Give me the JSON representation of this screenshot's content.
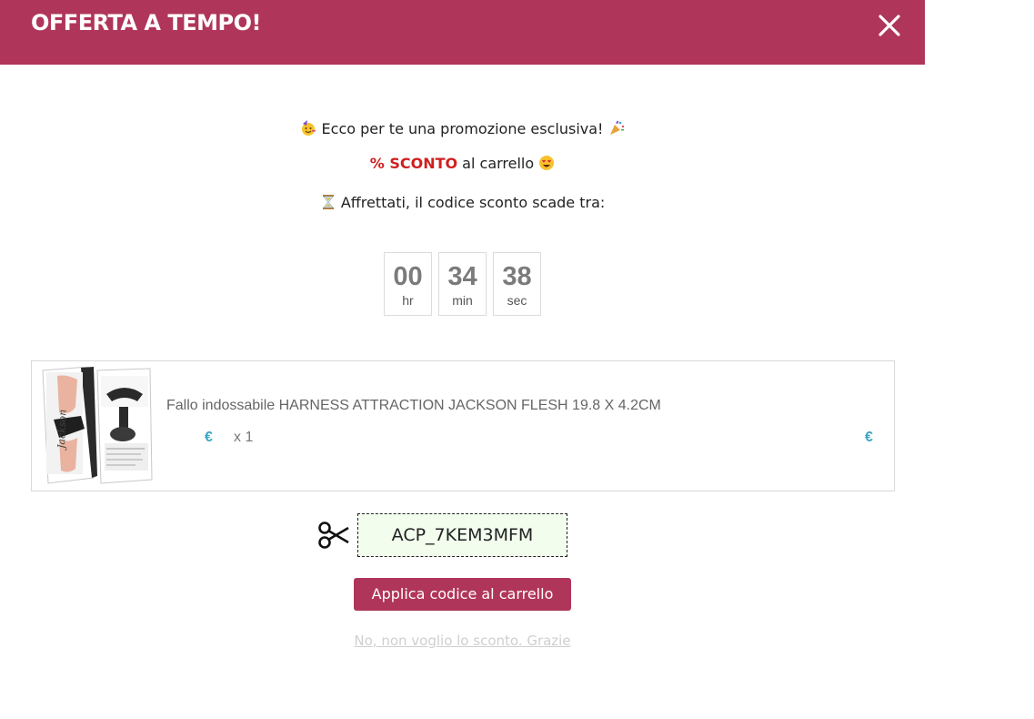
{
  "header": {
    "title": "OFFERTA A TEMPO!"
  },
  "promo": {
    "line1": "Ecco per te una promozione esclusiva!",
    "line2_highlight": "%  SCONTO",
    "line2_rest": " al carrello",
    "line3": "Affrettati, il codice sconto scade tra:"
  },
  "timer": {
    "hours": "00",
    "hours_label": "hr",
    "minutes": "34",
    "minutes_label": "min",
    "seconds": "38",
    "seconds_label": "sec"
  },
  "product": {
    "name": "Fallo indossabile HARNESS ATTRACTION JACKSON FLESH 19.8 X 4.2CM",
    "price_unit": "€",
    "quantity": "x 1",
    "price_total": "€",
    "image_brand_text": "Jackson"
  },
  "coupon": {
    "code": "ACP_7KEM3MFM"
  },
  "actions": {
    "apply_label": "Applica codice al carrello",
    "decline_label": "No, non voglio lo sconto. Grazie"
  },
  "icons": {
    "close": "close-icon",
    "party_face": "partying-face-icon",
    "party_popper": "party-popper-icon",
    "heart_eyes": "heart-eyes-icon",
    "hourglass": "hourglass-icon",
    "scissors": "scissors-icon"
  },
  "colors": {
    "brand": "#b0355a",
    "promo_red": "#d01f1f",
    "price_blue": "#3aa6c2",
    "coupon_bg": "#f2fdee"
  }
}
